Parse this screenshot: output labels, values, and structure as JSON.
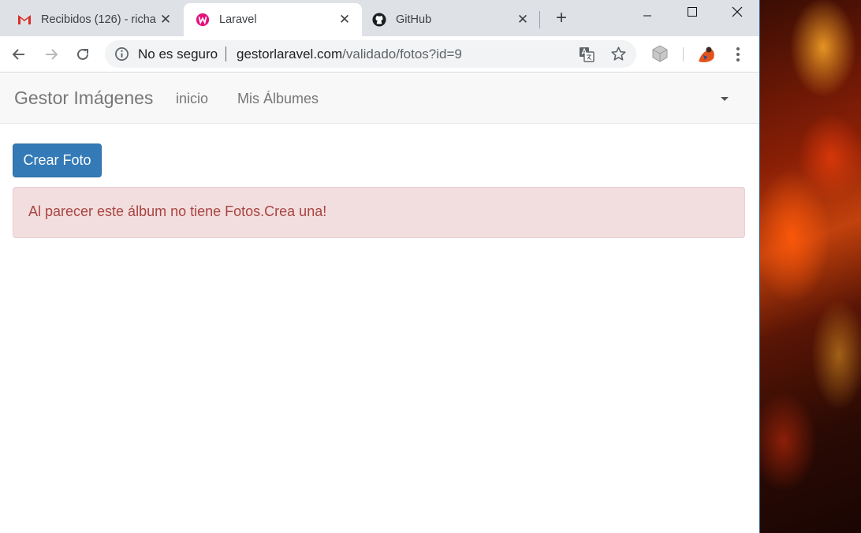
{
  "browser": {
    "tabs": [
      {
        "title": "Recibidos (126) - richa",
        "icon": "gmail-icon",
        "active": false
      },
      {
        "title": "Laravel",
        "icon": "laravel-icon",
        "active": true
      },
      {
        "title": "GitHub",
        "icon": "github-icon",
        "active": false
      }
    ],
    "close_glyph": "✕",
    "new_tab_glyph": "+",
    "security_label": "No es seguro",
    "url_host": "gestorlaravel.com",
    "url_path": "/validado/fotos?id=9"
  },
  "app": {
    "brand": "Gestor Imágenes",
    "nav": [
      {
        "label": "inicio"
      },
      {
        "label": "Mis Álbumes"
      }
    ],
    "create_button": "Crear Foto",
    "alert_message": "Al parecer este álbum no tiene Fotos.Crea una!"
  },
  "colors": {
    "primary": "#337ab7",
    "alert_bg": "#f2dede",
    "alert_text": "#a94442",
    "navbar_bg": "#f8f8f8"
  }
}
